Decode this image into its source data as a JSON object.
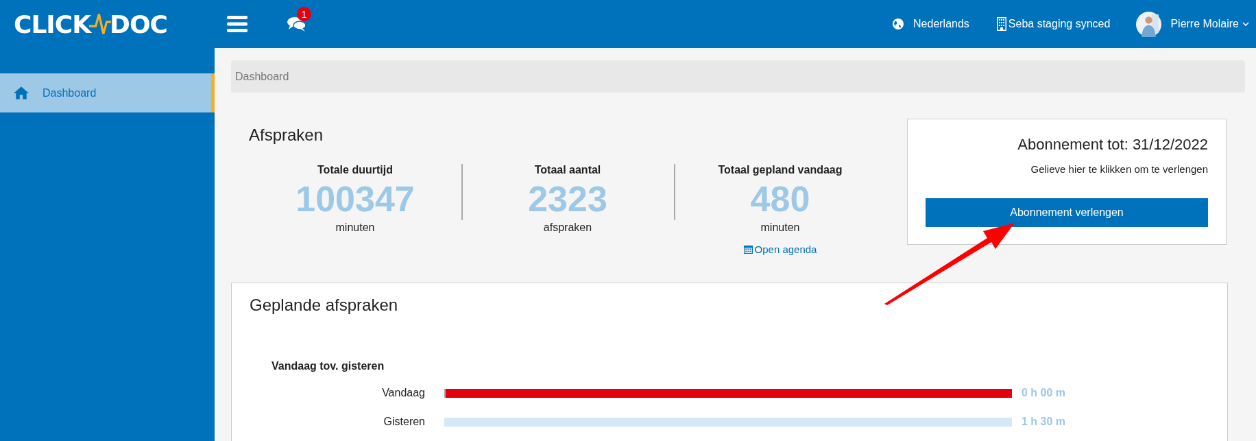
{
  "header": {
    "logo_left": "CLICK",
    "logo_right": "DOC",
    "notifications": "1",
    "language": "Nederlands",
    "organization": "Seba staging synced",
    "user": "Pierre Molaire"
  },
  "sidebar": {
    "items": [
      {
        "label": "Dashboard",
        "selected": true
      }
    ]
  },
  "breadcrumb": "Dashboard",
  "appointments": {
    "title": "Afspraken",
    "stats": [
      {
        "label": "Totale duurtijd",
        "value": "100347",
        "unit": "minuten"
      },
      {
        "label": "Totaal aantal",
        "value": "2323",
        "unit": "afspraken"
      },
      {
        "label": "Totaal gepland vandaag",
        "value": "480",
        "unit": "minuten",
        "link": "Open agenda"
      }
    ]
  },
  "subscription": {
    "title": "Abonnement tot: 31/12/2022",
    "hint": "Gelieve hier te klikken om te verlengen",
    "button": "Abonnement verlengen"
  },
  "planned": {
    "title": "Geplande afspraken",
    "subtitle": "Vandaag tov. gisteren",
    "bars": [
      {
        "label": "Vandaag",
        "value": "0 h 00 m",
        "level": 0.003,
        "color": "#e3000f"
      },
      {
        "label": "Gisteren",
        "value": "1 h 30 m",
        "color": "#d5e8f5"
      }
    ]
  }
}
